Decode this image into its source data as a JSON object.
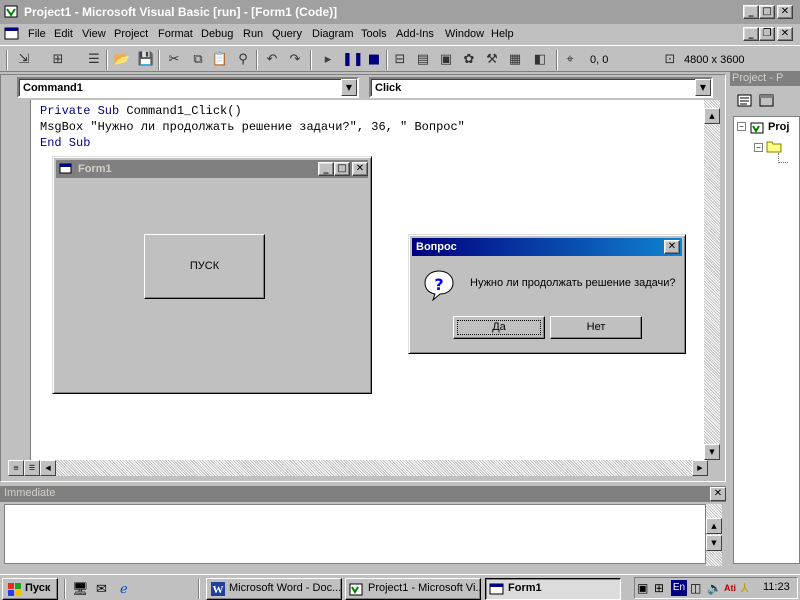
{
  "window": {
    "title": "Project1 - Microsoft Visual Basic [run] - [Form1 (Code)]",
    "caption_buttons": [
      "minimize",
      "maximize",
      "close"
    ]
  },
  "menu": {
    "items": [
      "File",
      "Edit",
      "View",
      "Project",
      "Format",
      "Debug",
      "Run",
      "Query",
      "Diagram",
      "Tools",
      "Add-Ins",
      "Window",
      "Help"
    ]
  },
  "toolbar": {
    "position_readout": "0, 0",
    "size_readout": "4800 x 3600",
    "icons": [
      "add-project-icon",
      "add-form-icon",
      "menu-editor-icon",
      "open-icon",
      "save-icon",
      "cut-icon",
      "copy-icon",
      "paste-icon",
      "find-icon",
      "undo-icon",
      "redo-icon",
      "start-icon",
      "break-icon",
      "end-icon",
      "project-explorer-icon",
      "properties-icon",
      "form-layout-icon",
      "object-browser-icon",
      "toolbox-icon",
      "data-view-icon",
      "component-manager-icon"
    ]
  },
  "code_window": {
    "object_combo": "Command1",
    "procedure_combo": "Click",
    "lines": [
      {
        "kw": "Private Sub ",
        "text": "Command1_Click()"
      },
      {
        "kw": "",
        "text": "MsgBox \"Нужно ли продолжать решение задачи?\", 36, \" Вопрос\""
      },
      {
        "kw": "End Sub",
        "text": ""
      }
    ]
  },
  "form1": {
    "title": "Form1",
    "button_label": "ПУСК"
  },
  "msgbox": {
    "title": "Вопрос",
    "message": "Нужно ли продолжать решение задачи?",
    "yes_label": "Да",
    "no_label": "Нет"
  },
  "immediate": {
    "title": "Immediate"
  },
  "project_pane": {
    "title": "Project - P",
    "tree_root": "Proj"
  },
  "taskbar": {
    "start_label": "Пуск",
    "buttons": [
      {
        "label": "Microsoft Word - Doc..."
      },
      {
        "label": "Project1 - Microsoft Vi..."
      },
      {
        "label": "Form1"
      }
    ],
    "lang": "En",
    "clock": "11:23"
  }
}
